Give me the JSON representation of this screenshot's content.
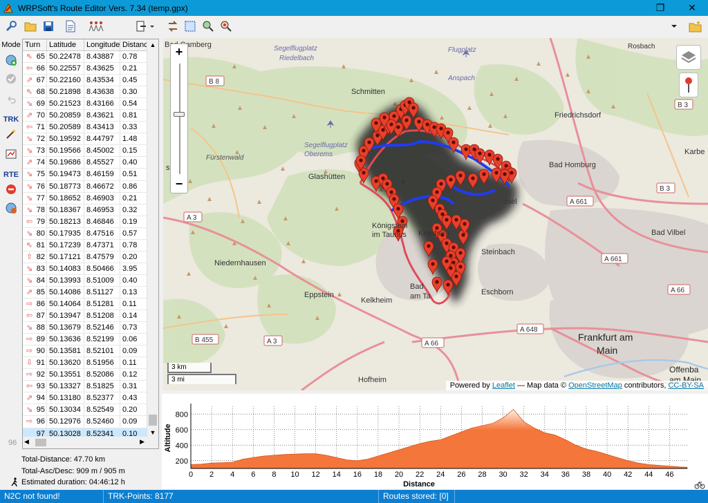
{
  "window": {
    "title": "WRPSoft's Route Editor Vers. 7.34 (temp.gpx)",
    "restore_glyph": "❐",
    "close_glyph": "✕"
  },
  "modes": {
    "mode_label": "Mode",
    "trk_label": "TRK",
    "rte_label": "RTE"
  },
  "table": {
    "headers": [
      "Turn",
      "Latitude",
      "Longitude",
      "Distanc"
    ],
    "rows": [
      {
        "turn": "65",
        "lat": "50.22478",
        "lon": "8.43887",
        "dist": "0.78",
        "arrow": "⇖"
      },
      {
        "turn": "66",
        "lat": "50.22557",
        "lon": "8.43625",
        "dist": "0.21",
        "arrow": "⇦"
      },
      {
        "turn": "67",
        "lat": "50.22160",
        "lon": "8.43534",
        "dist": "0.45",
        "arrow": "⇗"
      },
      {
        "turn": "68",
        "lat": "50.21898",
        "lon": "8.43638",
        "dist": "0.30",
        "arrow": "⇖"
      },
      {
        "turn": "69",
        "lat": "50.21523",
        "lon": "8.43166",
        "dist": "0.54",
        "arrow": "⇘"
      },
      {
        "turn": "70",
        "lat": "50.20859",
        "lon": "8.43621",
        "dist": "0.81",
        "arrow": "⇗"
      },
      {
        "turn": "71",
        "lat": "50.20589",
        "lon": "8.43413",
        "dist": "0.33",
        "arrow": "⇦"
      },
      {
        "turn": "72",
        "lat": "50.19592",
        "lon": "8.44797",
        "dist": "1.48",
        "arrow": "⇘"
      },
      {
        "turn": "73",
        "lat": "50.19566",
        "lon": "8.45002",
        "dist": "0.15",
        "arrow": "⇘"
      },
      {
        "turn": "74",
        "lat": "50.19686",
        "lon": "8.45527",
        "dist": "0.40",
        "arrow": "⇗"
      },
      {
        "turn": "75",
        "lat": "50.19473",
        "lon": "8.46159",
        "dist": "0.51",
        "arrow": "⇘"
      },
      {
        "turn": "76",
        "lat": "50.18773",
        "lon": "8.46672",
        "dist": "0.86",
        "arrow": "⇘"
      },
      {
        "turn": "77",
        "lat": "50.18652",
        "lon": "8.46903",
        "dist": "0.21",
        "arrow": "⇘"
      },
      {
        "turn": "78",
        "lat": "50.18367",
        "lon": "8.46953",
        "dist": "0.32",
        "arrow": "⇘"
      },
      {
        "turn": "79",
        "lat": "50.18213",
        "lon": "8.46846",
        "dist": "0.19",
        "arrow": "⇦"
      },
      {
        "turn": "80",
        "lat": "50.17935",
        "lon": "8.47516",
        "dist": "0.57",
        "arrow": "⇘"
      },
      {
        "turn": "81",
        "lat": "50.17239",
        "lon": "8.47371",
        "dist": "0.78",
        "arrow": "⇖"
      },
      {
        "turn": "82",
        "lat": "50.17121",
        "lon": "8.47579",
        "dist": "0.20",
        "arrow": "⇧"
      },
      {
        "turn": "83",
        "lat": "50.14083",
        "lon": "8.50466",
        "dist": "3.95",
        "arrow": "⇘"
      },
      {
        "turn": "84",
        "lat": "50.13993",
        "lon": "8.51009",
        "dist": "0.40",
        "arrow": "⇘"
      },
      {
        "turn": "85",
        "lat": "50.14086",
        "lon": "8.51127",
        "dist": "0.13",
        "arrow": "⇗"
      },
      {
        "turn": "86",
        "lat": "50.14064",
        "lon": "8.51281",
        "dist": "0.11",
        "arrow": "⇨"
      },
      {
        "turn": "87",
        "lat": "50.13947",
        "lon": "8.51208",
        "dist": "0.14",
        "arrow": "⇦"
      },
      {
        "turn": "88",
        "lat": "50.13679",
        "lon": "8.52146",
        "dist": "0.73",
        "arrow": "⇘"
      },
      {
        "turn": "89",
        "lat": "50.13636",
        "lon": "8.52199",
        "dist": "0.06",
        "arrow": "⇨"
      },
      {
        "turn": "90",
        "lat": "50.13581",
        "lon": "8.52101",
        "dist": "0.09",
        "arrow": "⇨"
      },
      {
        "turn": "91",
        "lat": "50.13620",
        "lon": "8.51956",
        "dist": "0.11",
        "arrow": "⇩"
      },
      {
        "turn": "92",
        "lat": "50.13551",
        "lon": "8.52086",
        "dist": "0.12",
        "arrow": "⇨"
      },
      {
        "turn": "93",
        "lat": "50.13327",
        "lon": "8.51825",
        "dist": "0.31",
        "arrow": "⇦"
      },
      {
        "turn": "94",
        "lat": "50.13180",
        "lon": "8.52377",
        "dist": "0.43",
        "arrow": "⇗"
      },
      {
        "turn": "95",
        "lat": "50.13034",
        "lon": "8.52549",
        "dist": "0.20",
        "arrow": "⇘"
      },
      {
        "turn": "96",
        "lat": "50.12976",
        "lon": "8.52460",
        "dist": "0.09",
        "arrow": "⇨"
      },
      {
        "turn": "97",
        "lat": "50.13028",
        "lon": "8.52341",
        "dist": "0.10",
        "arrow": ""
      }
    ],
    "side_number": "96"
  },
  "stats": {
    "total_distance": "Total-Distance: 47.70 km",
    "total_asc_desc": "Total-Asc/Desc: 909 m / 905 m",
    "estimated_duration": "Estimated duration: 04:46:12 h"
  },
  "map": {
    "zoom_in": "+",
    "zoom_out": "−",
    "scale_km": "3 km",
    "scale_mi": "3 mi",
    "attribution_prefix": "Powered by",
    "leaflet": "Leaflet",
    "attribution_mid": "— Map data ©",
    "osm": "OpenStreetMap",
    "attribution_suffix": "contributors,",
    "license": "CC-BY-SA",
    "labels": [
      {
        "text": "Bad Camberg",
        "size": 11,
        "color": "#333"
      },
      {
        "text": "Segelflugplatz",
        "size": 10,
        "color": "#6a6aa8"
      },
      {
        "text": "Riedelbach",
        "size": 10,
        "color": "#6a6aa8"
      },
      {
        "text": "Flugplatz",
        "size": 10,
        "color": "#6a6aa8"
      },
      {
        "text": "Anspach",
        "size": 10,
        "color": "#6a6aa8"
      },
      {
        "text": "Rosbach",
        "size": 10,
        "color": "#333"
      },
      {
        "text": "Schmitten",
        "size": 11,
        "color": "#333"
      },
      {
        "text": "Friedrichsdorf",
        "size": 11,
        "color": "#333"
      },
      {
        "text": "Segelflugplatz",
        "size": 10,
        "color": "#6a6aa8"
      },
      {
        "text": "Oberems",
        "size": 10,
        "color": "#6a6aa8"
      },
      {
        "text": "Fürstenwald",
        "size": 10,
        "color": "#555"
      },
      {
        "text": "stein",
        "size": 11,
        "color": "#333"
      },
      {
        "text": "Glashütten",
        "size": 11,
        "color": "#333"
      },
      {
        "text": "Bad Homburg",
        "size": 11,
        "color": "#333"
      },
      {
        "text": "Karbe",
        "size": 11,
        "color": "#333"
      },
      {
        "text": "Königstein",
        "size": 11,
        "color": "#333"
      },
      {
        "text": "im Taunus",
        "size": 11,
        "color": "#333"
      },
      {
        "text": "Kronberg",
        "size": 11,
        "color": "#333"
      },
      {
        "text": "Steinbach",
        "size": 11,
        "color": "#333"
      },
      {
        "text": "Bad Vilbel",
        "size": 11,
        "color": "#333"
      },
      {
        "text": "Niedernhausen",
        "size": 11,
        "color": "#333"
      },
      {
        "text": "Eppstein",
        "size": 11,
        "color": "#333"
      },
      {
        "text": "Bad",
        "size": 11,
        "color": "#333"
      },
      {
        "text": "am Ta",
        "size": 11,
        "color": "#333"
      },
      {
        "text": "Kelkheim",
        "size": 11,
        "color": "#333"
      },
      {
        "text": "Eschborn",
        "size": 11,
        "color": "#333"
      },
      {
        "text": "Frankfurt am",
        "size": 14,
        "color": "#222"
      },
      {
        "text": "Main",
        "size": 14,
        "color": "#222"
      },
      {
        "text": "Hofheim",
        "size": 11,
        "color": "#333"
      },
      {
        "text": "Offenba",
        "size": 12,
        "color": "#222"
      },
      {
        "text": "am Main",
        "size": 12,
        "color": "#222"
      },
      {
        "text": "rsel",
        "size": 11,
        "color": "#333"
      }
    ],
    "road_shields": [
      "B 8",
      "B 3",
      "A 661",
      "B 3",
      "A 3",
      "A 661",
      "A 66",
      "A 648",
      "B 455",
      "A 3",
      "A 66"
    ]
  },
  "chart_data": {
    "type": "area",
    "xlabel": "Distance",
    "ylabel": "Altitude",
    "xticks": [
      0,
      2,
      4,
      6,
      8,
      10,
      12,
      14,
      16,
      18,
      20,
      22,
      24,
      26,
      28,
      30,
      32,
      34,
      36,
      38,
      40,
      42,
      44,
      46
    ],
    "yticks": [
      200,
      400,
      600,
      800
    ],
    "xlim": [
      0,
      47.7
    ],
    "ylim": [
      100,
      900
    ],
    "grid": true,
    "fill_color": "#f4763a",
    "x": [
      0,
      1,
      2,
      3,
      4,
      5,
      6,
      7,
      8,
      9,
      10,
      11,
      12,
      13,
      14,
      15,
      16,
      17,
      18,
      19,
      20,
      21,
      22,
      23,
      24,
      25,
      26,
      27,
      28,
      29,
      30,
      31,
      32,
      33,
      34,
      35,
      36,
      37,
      38,
      39,
      40,
      41,
      42,
      43,
      44,
      45,
      46,
      47,
      47.7
    ],
    "y": [
      150,
      155,
      170,
      175,
      180,
      220,
      240,
      260,
      270,
      280,
      285,
      290,
      290,
      270,
      240,
      210,
      200,
      220,
      260,
      300,
      340,
      380,
      420,
      450,
      470,
      520,
      570,
      620,
      650,
      680,
      750,
      860,
      700,
      620,
      560,
      530,
      470,
      400,
      350,
      320,
      280,
      240,
      200,
      170,
      150,
      140,
      130,
      120,
      115
    ]
  },
  "status": {
    "n2c": "N2C not found!",
    "trk_points": "TRK-Points: 8177",
    "routes_stored": "Routes stored: [0]"
  }
}
